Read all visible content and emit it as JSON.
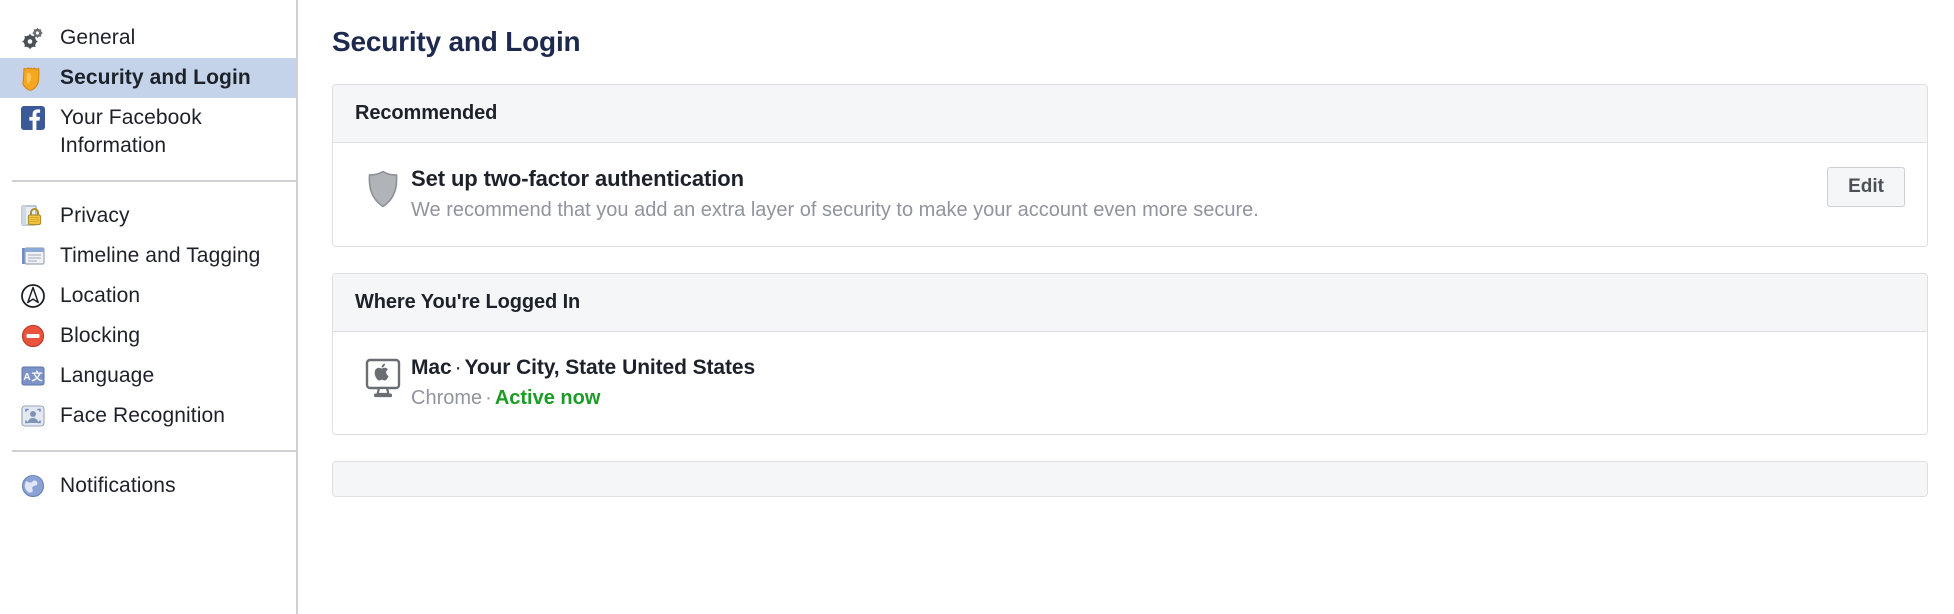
{
  "sidebar": {
    "groups": [
      {
        "items": [
          {
            "label": "General",
            "icon": "gears-icon",
            "active": false
          },
          {
            "label": "Security and Login",
            "icon": "shield-badge-icon",
            "active": true
          },
          {
            "label": "Your Facebook Information",
            "icon": "facebook-icon",
            "active": false
          }
        ]
      },
      {
        "items": [
          {
            "label": "Privacy",
            "icon": "lock-icon",
            "active": false
          },
          {
            "label": "Timeline and Tagging",
            "icon": "timeline-icon",
            "active": false
          },
          {
            "label": "Location",
            "icon": "compass-icon",
            "active": false
          },
          {
            "label": "Blocking",
            "icon": "block-icon",
            "active": false
          },
          {
            "label": "Language",
            "icon": "language-icon",
            "active": false
          },
          {
            "label": "Face Recognition",
            "icon": "face-recognition-icon",
            "active": false
          }
        ]
      },
      {
        "items": [
          {
            "label": "Notifications",
            "icon": "globe-icon",
            "active": false
          }
        ]
      }
    ]
  },
  "main": {
    "page_title": "Security and Login",
    "recommended": {
      "header": "Recommended",
      "item": {
        "icon": "shield-icon",
        "title": "Set up two-factor authentication",
        "description": "We recommend that you add an extra layer of security to make your account even more secure.",
        "action_label": "Edit"
      }
    },
    "logged_in": {
      "header": "Where You're Logged In",
      "session": {
        "icon": "mac-desktop-icon",
        "device": "Mac",
        "separator": "·",
        "city": "Your City, State",
        "country": "United States",
        "browser": "Chrome",
        "dot": "·",
        "status": "Active now"
      }
    },
    "next_section": {
      "header": ""
    }
  },
  "colors": {
    "accent": "#1d2a4d",
    "active_row": "#c4d3ea",
    "active_status": "#1c9c26",
    "muted_text": "#90949c",
    "border": "#dddfe2"
  }
}
